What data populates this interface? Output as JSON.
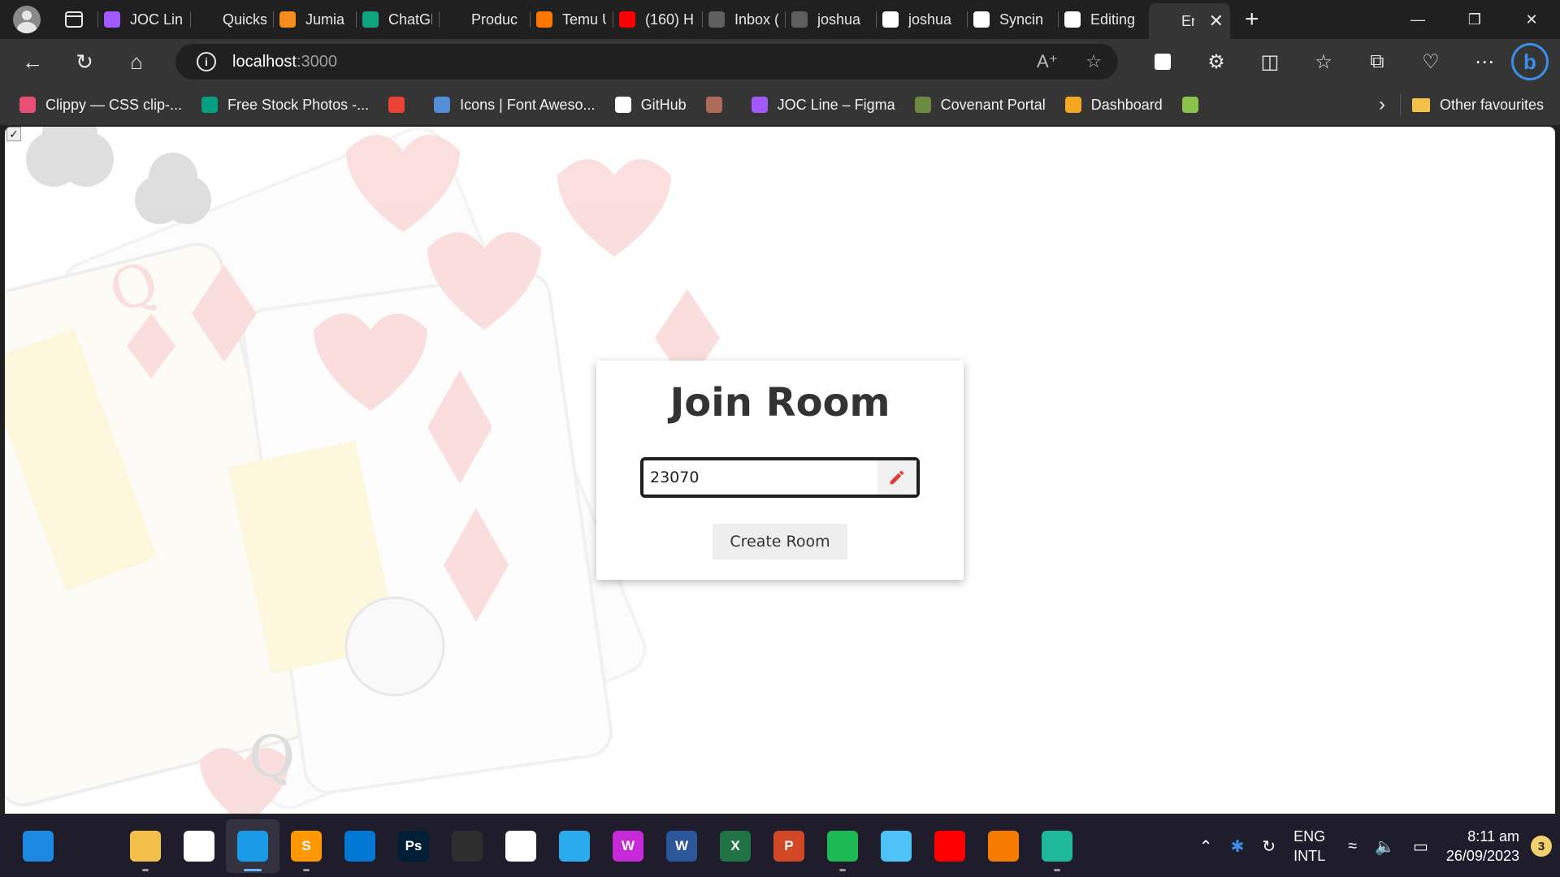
{
  "browser": {
    "tabs": [
      {
        "label": "JOC Lin",
        "favicon": "figma-icon",
        "color": "#a259ff"
      },
      {
        "label": "Quickst",
        "favicon": "blank-icon",
        "color": "#202020"
      },
      {
        "label": "Jumia N",
        "favicon": "jumia-icon",
        "color": "#f68b1e"
      },
      {
        "label": "ChatGP",
        "favicon": "chatgpt-icon",
        "color": "#10a37f"
      },
      {
        "label": "Produc",
        "favicon": "page-icon",
        "color": "#202020"
      },
      {
        "label": "Temu U",
        "favicon": "temu-icon",
        "color": "#fb7701"
      },
      {
        "label": "(160) H",
        "favicon": "youtube-icon",
        "color": "#ff0000"
      },
      {
        "label": "Inbox (",
        "favicon": "gmail-icon",
        "color": "#5f5f5f"
      },
      {
        "label": "joshua",
        "favicon": "gmail-icon",
        "color": "#5f5f5f"
      },
      {
        "label": "joshua",
        "favicon": "github-icon",
        "color": "#ffffff"
      },
      {
        "label": "Syncin",
        "favicon": "github-icon",
        "color": "#ffffff"
      },
      {
        "label": "Editing",
        "favicon": "github-icon",
        "color": "#ffffff"
      },
      {
        "label": "Ent",
        "favicon": "page-icon",
        "color": "#353535"
      }
    ],
    "address": {
      "host": "localhost",
      "port": ":3000"
    },
    "bookmarks": [
      {
        "label": "Clippy — CSS clip-...",
        "icon": "clippy-icon",
        "color": "#e94e77"
      },
      {
        "label": "Free Stock Photos -...",
        "icon": "pexels-icon",
        "color": "#05a081"
      },
      {
        "label": "",
        "icon": "gmail-icon",
        "color": "#ea4335"
      },
      {
        "label": "Icons | Font Aweso...",
        "icon": "font-awesome-icon",
        "color": "#538dd7"
      },
      {
        "label": "GitHub",
        "icon": "github-icon",
        "color": "#ffffff"
      },
      {
        "label": "",
        "icon": "avatar-icon",
        "color": "#b06a5a"
      },
      {
        "label": "JOC Line – Figma",
        "icon": "figma-icon",
        "color": "#a259ff"
      },
      {
        "label": "Covenant Portal",
        "icon": "covenant-icon",
        "color": "#6c8a3f"
      },
      {
        "label": "Dashboard",
        "icon": "dashboard-icon",
        "color": "#f5a623"
      },
      {
        "label": "",
        "icon": "download-icon",
        "color": "#8bc34a"
      }
    ],
    "other_favourites": "Other favourites"
  },
  "page": {
    "title": "Join Room",
    "room_code": "23070",
    "create_button": "Create Room",
    "accent_color": "#e53935"
  },
  "taskbar": {
    "apps": [
      {
        "name": "windows-start-icon",
        "label": "",
        "color": "#1e88e5"
      },
      {
        "name": "search-icon",
        "label": "",
        "color": "#1f1d2b"
      },
      {
        "name": "file-explorer-icon",
        "label": "",
        "color": "#f3c14b"
      },
      {
        "name": "microsoft-store-icon",
        "label": "",
        "color": "#ffffff"
      },
      {
        "name": "edge-icon",
        "label": "",
        "color": "#1a9be8"
      },
      {
        "name": "sublime-text-icon",
        "label": "S",
        "color": "#ff9800"
      },
      {
        "name": "vscode-icon",
        "label": "",
        "color": "#0078d4"
      },
      {
        "name": "photoshop-icon",
        "label": "Ps",
        "color": "#001e36"
      },
      {
        "name": "git-icon",
        "label": "",
        "color": "#2e2e2e"
      },
      {
        "name": "mongodb-icon",
        "label": "",
        "color": "#ffffff"
      },
      {
        "name": "telegram-icon",
        "label": "",
        "color": "#2aabee"
      },
      {
        "name": "wps-office-icon",
        "label": "W",
        "color": "#c62ad8"
      },
      {
        "name": "word-icon",
        "label": "W",
        "color": "#2b579a"
      },
      {
        "name": "excel-icon",
        "label": "X",
        "color": "#217346"
      },
      {
        "name": "powerpoint-icon",
        "label": "P",
        "color": "#d24726"
      },
      {
        "name": "spotify-icon",
        "label": "",
        "color": "#1db954"
      },
      {
        "name": "notepad-icon",
        "label": "",
        "color": "#4fc3f7"
      },
      {
        "name": "youtube-music-icon",
        "label": "",
        "color": "#ff0000"
      },
      {
        "name": "vlc-icon",
        "label": "",
        "color": "#f57c00"
      },
      {
        "name": "edge-dev-icon",
        "label": "",
        "color": "#1fb89c"
      }
    ],
    "language": {
      "line1": "ENG",
      "line2": "INTL"
    },
    "time": "8:11 am",
    "date": "26/09/2023",
    "notifications": "3"
  }
}
